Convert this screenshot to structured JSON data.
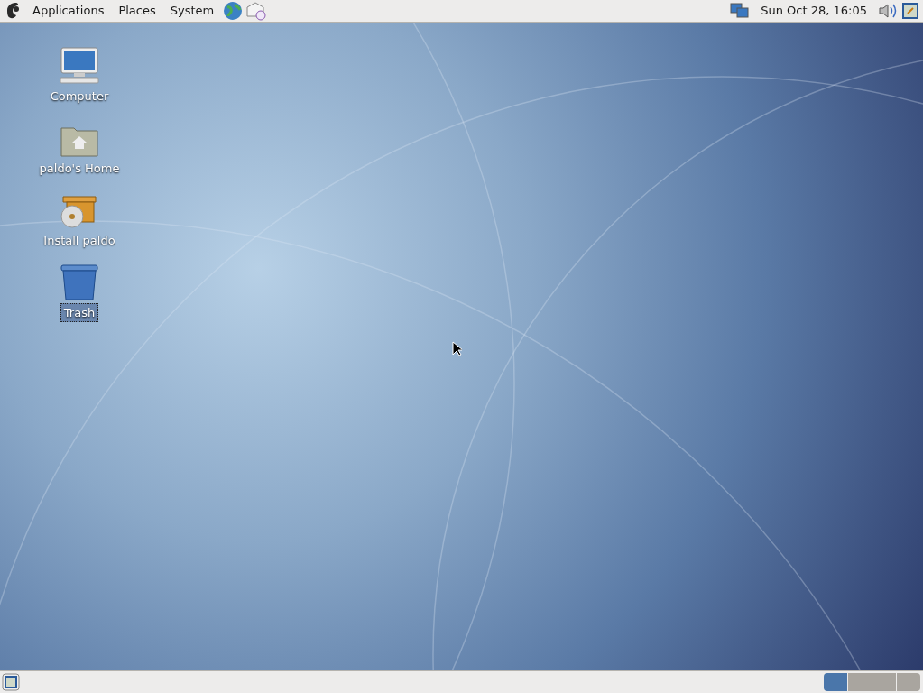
{
  "top_panel": {
    "menus": [
      {
        "label": "Applications"
      },
      {
        "label": "Places"
      },
      {
        "label": "System"
      }
    ],
    "clock": "Sun Oct 28, 16:05"
  },
  "desktop_icons": [
    {
      "kind": "computer",
      "label": "Computer",
      "selected": false
    },
    {
      "kind": "home",
      "label": "paldo's Home",
      "selected": false
    },
    {
      "kind": "installer",
      "label": "Install paldo",
      "selected": false
    },
    {
      "kind": "trash",
      "label": "Trash",
      "selected": true
    }
  ],
  "workspaces": [
    {
      "selected": true
    },
    {
      "selected": false
    },
    {
      "selected": false
    },
    {
      "selected": false
    }
  ]
}
